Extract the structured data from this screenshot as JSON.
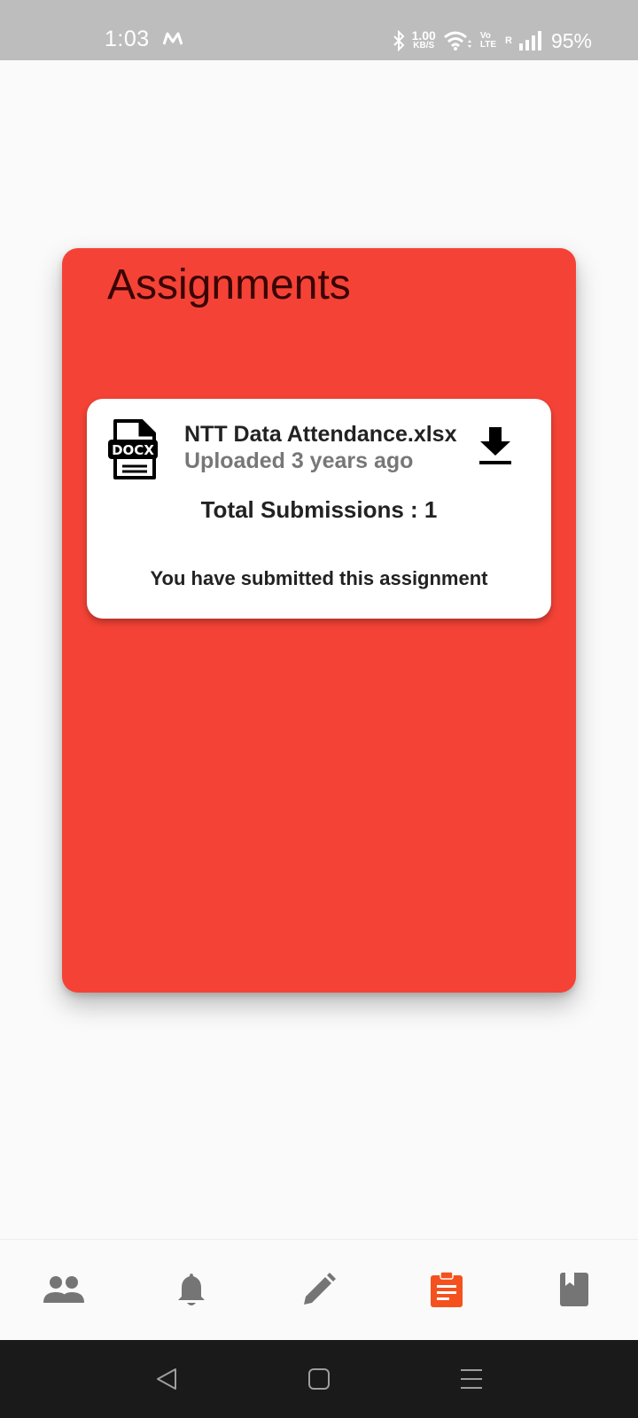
{
  "status_bar": {
    "time": "1:03",
    "carrier_icon": "m-logo-icon",
    "bluetooth_icon": "bluetooth-icon",
    "net_speed_value": "1.00",
    "net_speed_unit": "KB/S",
    "wifi_icon": "wifi-icon",
    "volte_line1": "Vo",
    "volte_line2": "LTE",
    "roaming": "R",
    "signal_icon": "signal-icon",
    "battery": "95%"
  },
  "panel": {
    "title": "Assignments",
    "color": "#f44336"
  },
  "assignment": {
    "file_type": "DOCX",
    "file_name": "NTT Data Attendance.xlsx",
    "uploaded": "Uploaded 3 years ago",
    "total_submissions": "Total Submissions : 1",
    "status_note": "You have submitted this assignment",
    "download_icon": "download-icon"
  },
  "bottom_nav": {
    "items": [
      {
        "icon": "people-icon",
        "active": false
      },
      {
        "icon": "bell-icon",
        "active": false
      },
      {
        "icon": "pencil-icon",
        "active": false
      },
      {
        "icon": "clipboard-icon",
        "active": true
      },
      {
        "icon": "bookmark-book-icon",
        "active": false
      }
    ],
    "active_color": "#f4511e",
    "inactive_color": "#757575"
  },
  "system_nav": {
    "back_icon": "back-triangle-icon",
    "home_icon": "home-square-icon",
    "menu_icon": "menu-lines-icon"
  }
}
